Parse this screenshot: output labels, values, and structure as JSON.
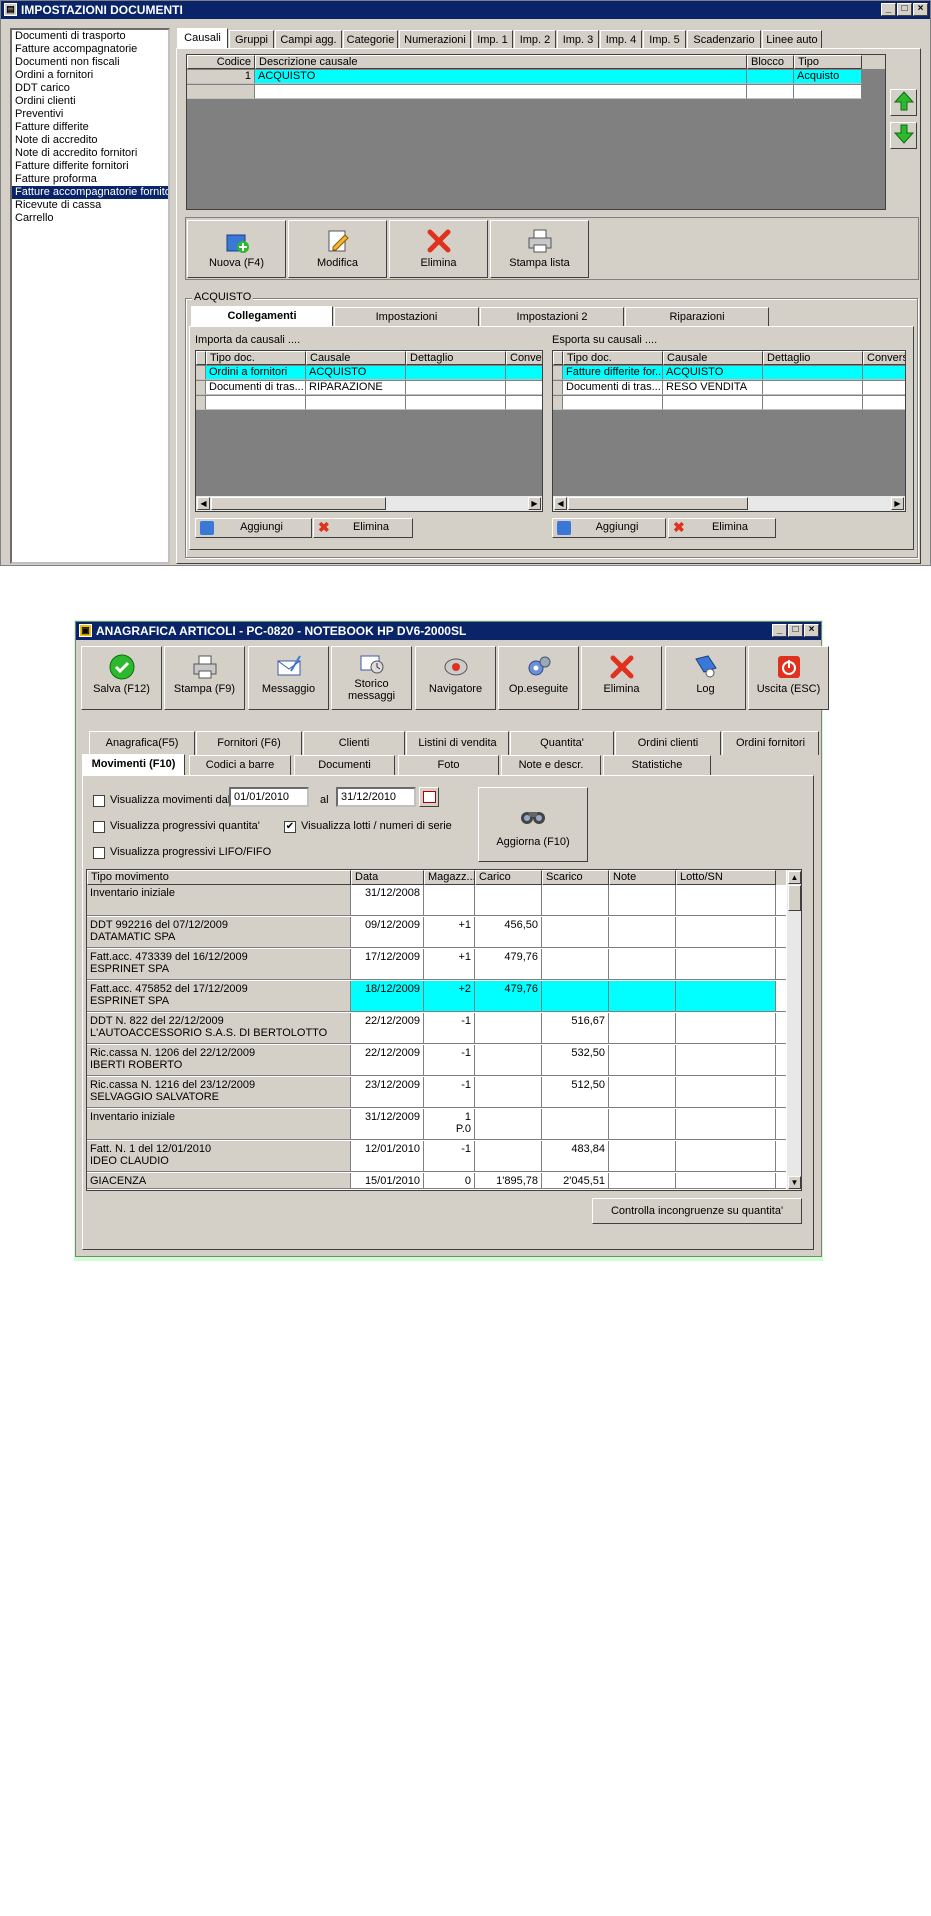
{
  "win1": {
    "title": "IMPOSTAZIONI DOCUMENTI",
    "sidebar": [
      "Documenti di trasporto",
      "Fatture accompagnatorie",
      "Documenti non fiscali",
      "Ordini a fornitori",
      "DDT carico",
      "Ordini clienti",
      "Preventivi",
      "Fatture differite",
      "Note di accredito",
      "Note di accredito fornitori",
      "Fatture differite fornitori",
      "Fatture proforma",
      "Fatture accompagnatorie fornitori",
      "Ricevute di cassa",
      "Carrello"
    ],
    "tabs": [
      "Causali",
      "Gruppi",
      "Campi agg.",
      "Categorie",
      "Numerazioni",
      "Imp. 1",
      "Imp. 2",
      "Imp. 3",
      "Imp. 4",
      "Imp. 5",
      "Scadenzario",
      "Linee auto"
    ],
    "causali_grid": {
      "headers": [
        "Codice",
        "Descrizione causale",
        "Blocco",
        "Tipo"
      ],
      "rows": [
        [
          "1",
          "ACQUISTO",
          "",
          "Acquisto"
        ]
      ]
    },
    "toolbar": {
      "nuova": "Nuova (F4)",
      "modifica": "Modifica",
      "elimina": "Elimina",
      "stampa": "Stampa lista"
    },
    "group_title": "ACQUISTO",
    "subtabs": [
      "Collegamenti",
      "Impostazioni",
      "Impostazioni 2",
      "Riparazioni"
    ],
    "importa_label": "Importa da causali ....",
    "esporta_label": "Esporta su causali ....",
    "importa_grid": {
      "headers": [
        "Tipo doc.",
        "Causale",
        "Dettaglio",
        "Conver"
      ],
      "rows": [
        [
          "Ordini a fornitori",
          "ACQUISTO",
          "",
          ""
        ],
        [
          "Documenti di tras...",
          "RIPARAZIONE",
          "",
          ""
        ]
      ]
    },
    "esporta_grid": {
      "headers": [
        "Tipo doc.",
        "Causale",
        "Dettaglio",
        "Conversi"
      ],
      "rows": [
        [
          "Fatture differite for...",
          "ACQUISTO",
          "",
          ""
        ],
        [
          "Documenti di tras...",
          "RESO VENDITA",
          "",
          ""
        ]
      ]
    },
    "aggiungi": "Aggiungi",
    "elimina_small": "Elimina"
  },
  "win2": {
    "title": "ANAGRAFICA ARTICOLI - PC-0820 - NOTEBOOK HP DV6-2000SL",
    "toolbar": [
      "Salva (F12)",
      "Stampa (F9)",
      "Messaggio",
      "Storico messaggi",
      "Navigatore",
      "Op.eseguite",
      "Elimina",
      "Log",
      "Uscita (ESC)"
    ],
    "tabs_row1": [
      "Anagrafica(F5)",
      "Fornitori (F6)",
      "Clienti",
      "Listini di vendita",
      "Quantita'",
      "Ordini clienti",
      "Ordini fornitori"
    ],
    "tabs_row2": [
      "Movimenti (F10)",
      "Codici a barre",
      "Documenti",
      "Foto",
      "Note e descr.",
      "Statistiche"
    ],
    "filters": {
      "movimenti_dal": "Visualizza movimenti dal",
      "date_from": "01/01/2010",
      "al": "al",
      "date_to": "31/12/2010",
      "prog_quantita": "Visualizza progressivi quantita'",
      "lotti": "Visualizza lotti /  numeri di serie",
      "lotti_check": "✔",
      "prog_lifo": "Visualizza progressivi LIFO/FIFO"
    },
    "aggiorna": "Aggiorna (F10)",
    "mov_headers": [
      "Tipo movimento",
      "Data",
      "Magazz...",
      "Carico",
      "Scarico",
      "Note",
      "Lotto/SN"
    ],
    "mov_rows": [
      {
        "tipo1": "Inventario iniziale",
        "tipo2": "",
        "data": "31/12/2008",
        "mag": "",
        "mag2": "",
        "carico": "",
        "scarico": "",
        "sel": false
      },
      {
        "tipo1": "DDT 992216 del 07/12/2009",
        "tipo2": "DATAMATIC SPA",
        "data": "09/12/2009",
        "mag": "+1",
        "mag2": "",
        "carico": "456,50",
        "scarico": "",
        "sel": false
      },
      {
        "tipo1": "Fatt.acc. 473339 del 16/12/2009",
        "tipo2": "ESPRINET SPA",
        "data": "17/12/2009",
        "mag": "+1",
        "mag2": "",
        "carico": "479,76",
        "scarico": "",
        "sel": false
      },
      {
        "tipo1": "Fatt.acc. 475852 del 17/12/2009",
        "tipo2": "ESPRINET SPA",
        "data": "18/12/2009",
        "mag": "+2",
        "mag2": "",
        "carico": "479,76",
        "scarico": "",
        "sel": true
      },
      {
        "tipo1": "DDT N. 822 del 22/12/2009",
        "tipo2": "L'AUTOACCESSORIO S.A.S. DI BERTOLOTTO",
        "data": "22/12/2009",
        "mag": "-1",
        "mag2": "",
        "carico": "",
        "scarico": "516,67",
        "sel": false
      },
      {
        "tipo1": "Ric.cassa N. 1206 del 22/12/2009",
        "tipo2": "IBERTI ROBERTO",
        "data": "22/12/2009",
        "mag": "-1",
        "mag2": "",
        "carico": "",
        "scarico": "532,50",
        "sel": false
      },
      {
        "tipo1": "Ric.cassa N. 1216 del 23/12/2009",
        "tipo2": "SELVAGGIO SALVATORE",
        "data": "23/12/2009",
        "mag": "-1",
        "mag2": "",
        "carico": "",
        "scarico": "512,50",
        "sel": false
      },
      {
        "tipo1": "Inventario iniziale",
        "tipo2": "",
        "data": "31/12/2009",
        "mag": "1",
        "mag2": "P.0",
        "carico": "",
        "scarico": "",
        "sel": false
      },
      {
        "tipo1": "Fatt. N. 1 del 12/01/2010",
        "tipo2": "IDEO CLAUDIO",
        "data": "12/01/2010",
        "mag": "-1",
        "mag2": "",
        "carico": "",
        "scarico": "483,84",
        "sel": false
      }
    ],
    "giacenza": {
      "tipo": "GIACENZA",
      "data": "15/01/2010",
      "mag": "0",
      "carico": "1'895,78",
      "scarico": "2'045,51"
    },
    "controlla": "Controlla incongruenze su quantita'"
  }
}
